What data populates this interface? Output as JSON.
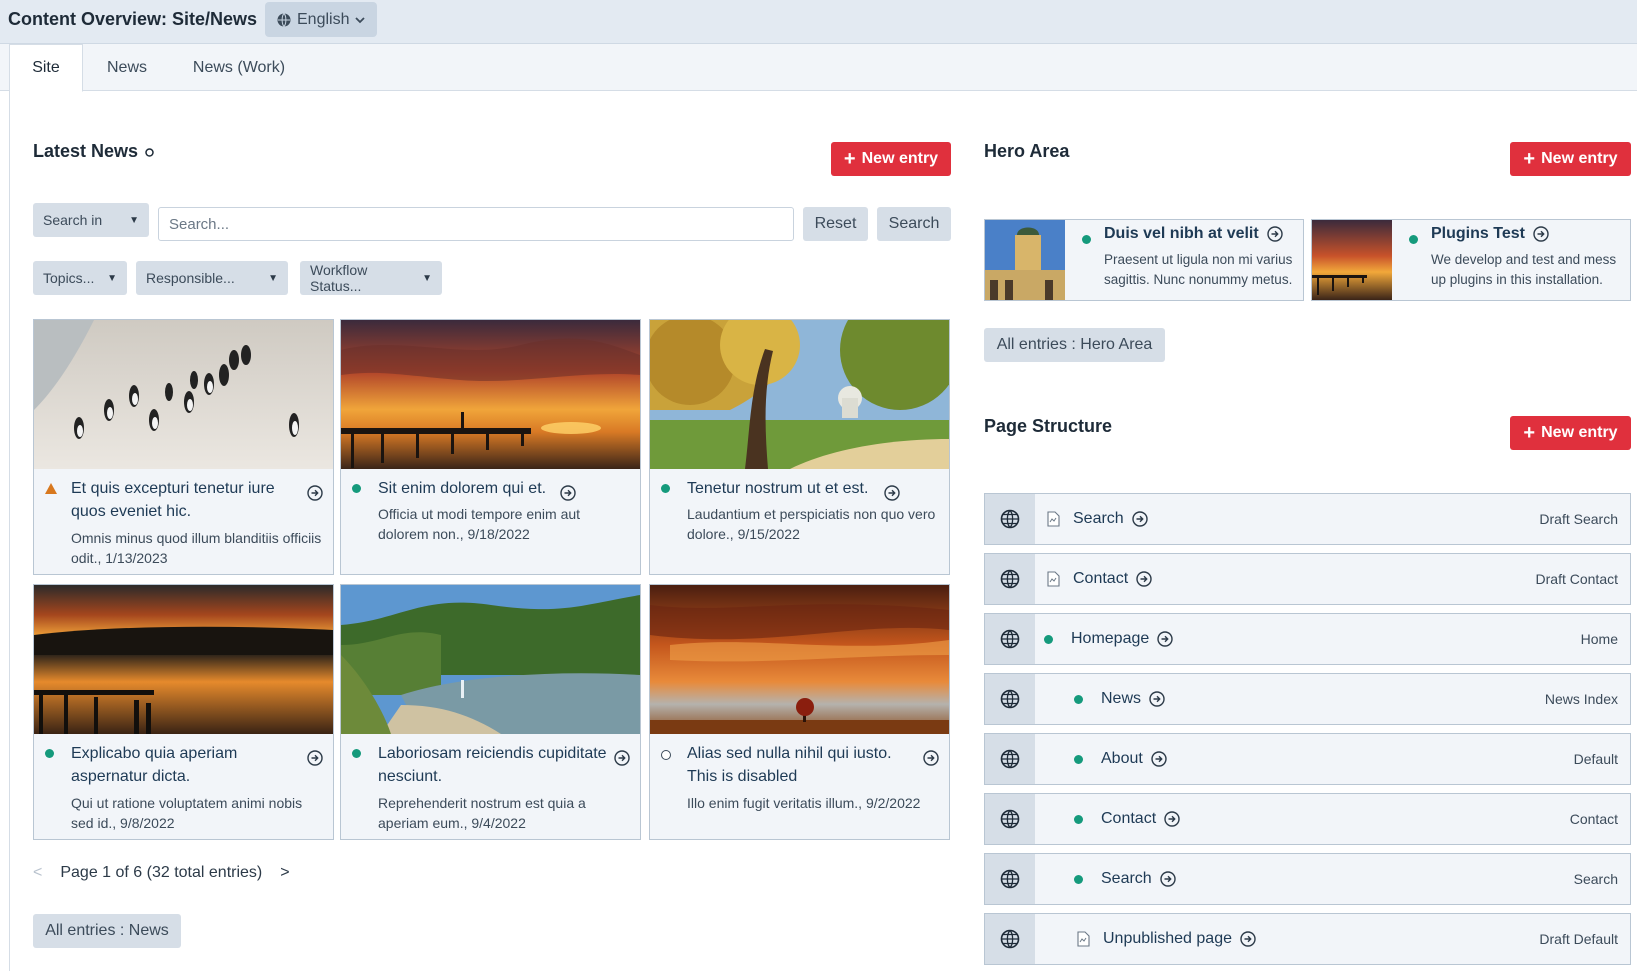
{
  "header": {
    "title": "Content Overview: Site/News",
    "language": "English"
  },
  "tabs": [
    {
      "label": "Site"
    },
    {
      "label": "News"
    },
    {
      "label": "News (Work)"
    }
  ],
  "latest_news": {
    "title": "Latest News",
    "new_entry": "New entry",
    "search_in": "Search in",
    "search_placeholder": "Search...",
    "reset": "Reset",
    "search": "Search",
    "filters": {
      "topics": "Topics...",
      "responsible": "Responsible...",
      "workflow": "Workflow Status..."
    },
    "cards": [
      {
        "title": "Et quis excepturi tenetur iure quos eveniet hic.",
        "desc": "Omnis minus quod illum blanditiis officiis odit., 1/13/2023",
        "status": "warning",
        "image": "penguins-photo"
      },
      {
        "title": "Sit enim dolorem qui et.",
        "desc": "Officia ut modi tempore enim aut dolorem non., 9/18/2022",
        "status": "published",
        "image": "pier-sunset-photo"
      },
      {
        "title": "Tenetur nostrum ut et est.",
        "desc": "Laudantium et perspiciatis non quo vero dolore., 9/15/2022",
        "status": "published",
        "image": "park-autumn-photo"
      },
      {
        "title": "Explicabo quia aperiam aspernatur dicta.",
        "desc": "Qui ut ratione voluptatem animi nobis sed id., 9/8/2022",
        "status": "published",
        "image": "lake-sunset-photo"
      },
      {
        "title": "Laboriosam reiciendis cupiditate nesciunt.",
        "desc": "Reprehenderit nostrum est quia a aperiam eum., 9/4/2022",
        "status": "published",
        "image": "river-photo"
      },
      {
        "title": "Alias sed nulla nihil qui iusto. This is disabled",
        "desc": "Illo enim fugit veritatis illum., 9/2/2022",
        "status": "disabled",
        "image": "orange-sky-tree-photo"
      }
    ],
    "pager": {
      "prev": "<",
      "text": "Page 1 of 6 (32 total entries)",
      "next": ">"
    },
    "all_entries": "All entries : News"
  },
  "hero_area": {
    "title": "Hero Area",
    "new_entry": "New entry",
    "items": [
      {
        "title": "Duis vel nibh at velit",
        "desc": "Praesent ut ligula non mi varius sagittis. Nunc nonummy metus.",
        "image": "church-photo"
      },
      {
        "title": "Plugins Test",
        "desc": "We develop and test and mess up plugins in this installation.",
        "image": "pier-sunset-thumb"
      }
    ],
    "all_entries": "All entries : Hero Area"
  },
  "page_structure": {
    "title": "Page Structure",
    "new_entry": "New entry",
    "rows": [
      {
        "label": "Search",
        "template": "Draft Search",
        "indent": 0,
        "state": "draft"
      },
      {
        "label": "Contact",
        "template": "Draft Contact",
        "indent": 0,
        "state": "draft"
      },
      {
        "label": "Homepage",
        "template": "Home",
        "indent": 0,
        "state": "published"
      },
      {
        "label": "News",
        "template": "News Index",
        "indent": 1,
        "state": "published"
      },
      {
        "label": "About",
        "template": "Default",
        "indent": 1,
        "state": "published"
      },
      {
        "label": "Contact",
        "template": "Contact",
        "indent": 1,
        "state": "published"
      },
      {
        "label": "Search",
        "template": "Search",
        "indent": 1,
        "state": "published"
      },
      {
        "label": "Unpublished page",
        "template": "Draft Default",
        "indent": 1,
        "state": "draft"
      }
    ]
  },
  "colors": {
    "accent_red": "#e0303d",
    "published_green": "#159a7c",
    "warning_orange": "#d8781e",
    "panel_bg": "#f2f5f9"
  }
}
